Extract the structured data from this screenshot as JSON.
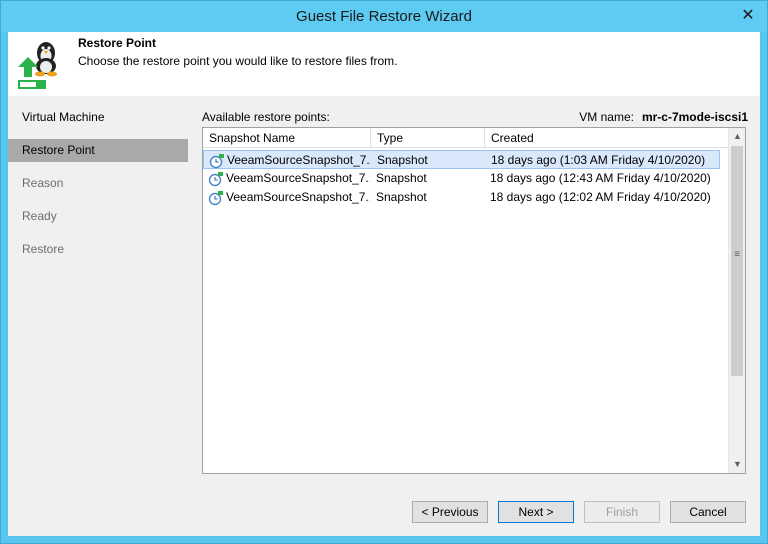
{
  "window": {
    "title": "Guest File Restore Wizard",
    "close_glyph": "✕"
  },
  "header": {
    "title": "Restore Point",
    "description": "Choose the restore point you would like to restore files from.",
    "icon": "linux-restore-icon"
  },
  "steps": [
    {
      "label": "Virtual Machine",
      "state": "done"
    },
    {
      "label": "Restore Point",
      "state": "active"
    },
    {
      "label": "Reason",
      "state": "pending"
    },
    {
      "label": "Ready",
      "state": "pending"
    },
    {
      "label": "Restore",
      "state": "pending"
    }
  ],
  "main": {
    "available_label": "Available restore points:",
    "vm_name_label": "VM name:",
    "vm_name_value": "mr-c-7mode-iscsi1"
  },
  "table": {
    "columns": [
      "Snapshot Name",
      "Type",
      "Created"
    ],
    "rows": [
      {
        "name": "VeeamSourceSnapshot_7...",
        "type": "Snapshot",
        "created": "18 days ago (1:03 AM Friday 4/10/2020)",
        "selected": true
      },
      {
        "name": "VeeamSourceSnapshot_7...",
        "type": "Snapshot",
        "created": "18 days ago (12:43 AM Friday 4/10/2020)",
        "selected": false
      },
      {
        "name": "VeeamSourceSnapshot_7...",
        "type": "Snapshot",
        "created": "18 days ago (12:02 AM Friday 4/10/2020)",
        "selected": false
      }
    ]
  },
  "buttons": {
    "previous": "< Previous",
    "next": "Next >",
    "finish": "Finish",
    "cancel": "Cancel"
  },
  "colors": {
    "title_bar": "#5ecbf2",
    "selection": "#d9e8fb",
    "active_step": "#a9a9a9"
  }
}
